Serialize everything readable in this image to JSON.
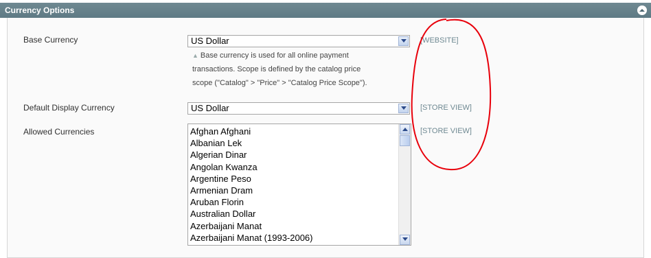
{
  "section": {
    "title": "Currency Options"
  },
  "fields": {
    "base_currency": {
      "label": "Base Currency",
      "value": "US Dollar",
      "scope": "[WEBSITE]",
      "note_lines": [
        "Base currency is used for all online payment",
        "transactions. Scope is defined by the catalog price",
        "scope (\"Catalog\" > \"Price\" > \"Catalog Price Scope\")."
      ]
    },
    "default_display_currency": {
      "label": "Default Display Currency",
      "value": "US Dollar",
      "scope": "[STORE VIEW]"
    },
    "allowed_currencies": {
      "label": "Allowed Currencies",
      "scope": "[STORE VIEW]",
      "options": [
        "Afghan Afghani",
        "Albanian Lek",
        "Algerian Dinar",
        "Angolan Kwanza",
        "Argentine Peso",
        "Armenian Dram",
        "Aruban Florin",
        "Australian Dollar",
        "Azerbaijani Manat",
        "Azerbaijani Manat (1993-2006)"
      ]
    }
  },
  "colors": {
    "header": "#6f8992",
    "scope_text": "#6f8992",
    "annotation": "#e8000b"
  },
  "icons": {
    "collapse": "collapse-up-icon",
    "dropdown": "chevron-down-icon"
  }
}
